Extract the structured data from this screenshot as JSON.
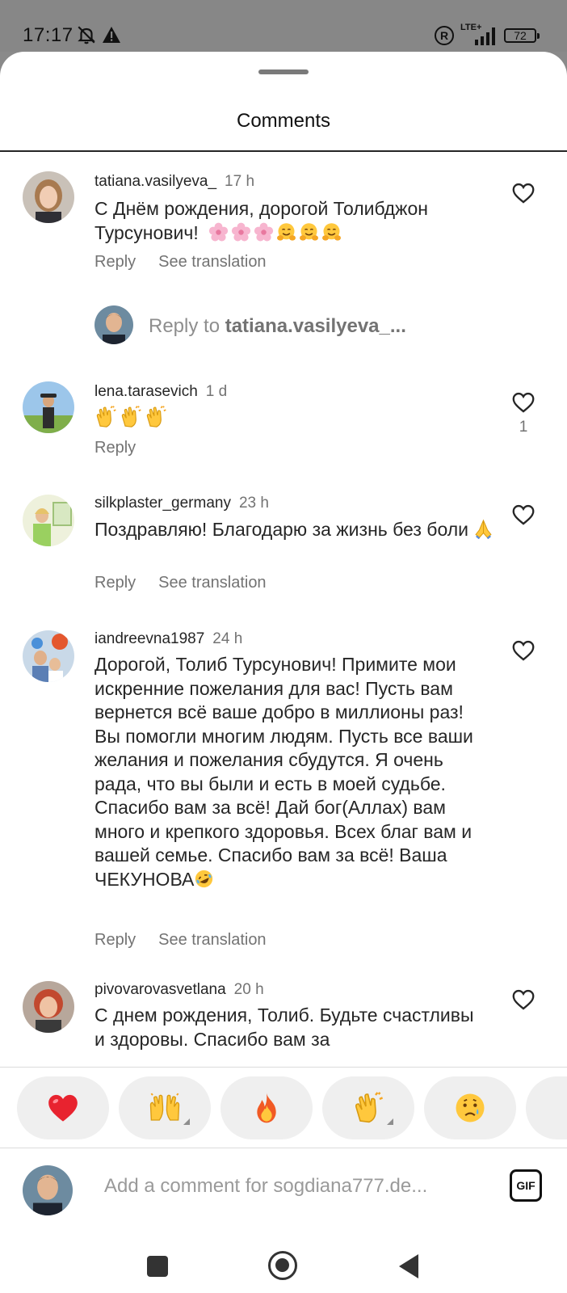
{
  "status_bar": {
    "time": "17:17",
    "network": "LTE+",
    "battery": "72"
  },
  "sheet": {
    "title": "Comments"
  },
  "comments": [
    {
      "username": "tatiana.vasilyeva_",
      "time": "17 h",
      "text": "С Днём рождения, дорогой Толибджон Турсунович!",
      "emojis": [
        "blossom",
        "blossom",
        "blossom",
        "hugging-face",
        "hugging-face",
        "hugging-face"
      ],
      "reply_label": "Reply",
      "translate_label": "See translation"
    },
    {
      "username": "lena.tarasevich",
      "time": "1 d",
      "text": "",
      "emojis": [
        "clapping-hands",
        "clapping-hands",
        "clapping-hands"
      ],
      "reply_label": "Reply",
      "likes": "1"
    },
    {
      "username": "silkplaster_germany",
      "time": "23 h",
      "text": "Поздравляю! Благодарю за жизнь без боли",
      "emojis": [
        "folded-hands"
      ],
      "reply_label": "Reply",
      "translate_label": "See translation"
    },
    {
      "username": "iandreevna1987",
      "time": "24 h",
      "text": "Дорогой, Толиб Турсунович! Примите мои искренние пожелания для вас! Пусть вам вернется всё ваше добро в миллионы раз! Вы помогли многим людям. Пусть все ваши  желания и пожелания сбудутся. Я очень рада, что вы были и есть в моей судьбе. Спасибо вам за всё! Дай бог(Аллах) вам много и крепкого здоровья. Всех благ вам и вашей семье. Спасибо вам за всё! Ваша ЧЕКУНОВА",
      "emojis": [
        "rolling-laughing"
      ],
      "reply_label": "Reply",
      "translate_label": "See translation"
    },
    {
      "username": "pivovarovasvetlana",
      "time": "20 h",
      "text": "С днем рождения, Толиб. Будьте счастливы и здоровы. Спасибо вам за"
    }
  ],
  "reply_prompt": {
    "prefix": "Reply to",
    "username": "tatiana.vasilyeva_..."
  },
  "reactions": [
    "red-heart",
    "raising-hands",
    "fire",
    "clapping-hands",
    "crying-face"
  ],
  "composer": {
    "placeholder": "Add a comment for sogdiana777.de...",
    "gif_label": "GIF"
  },
  "colors": {
    "secondary_text": "#737373",
    "text": "#262626",
    "heart_red": "#e8232f"
  }
}
